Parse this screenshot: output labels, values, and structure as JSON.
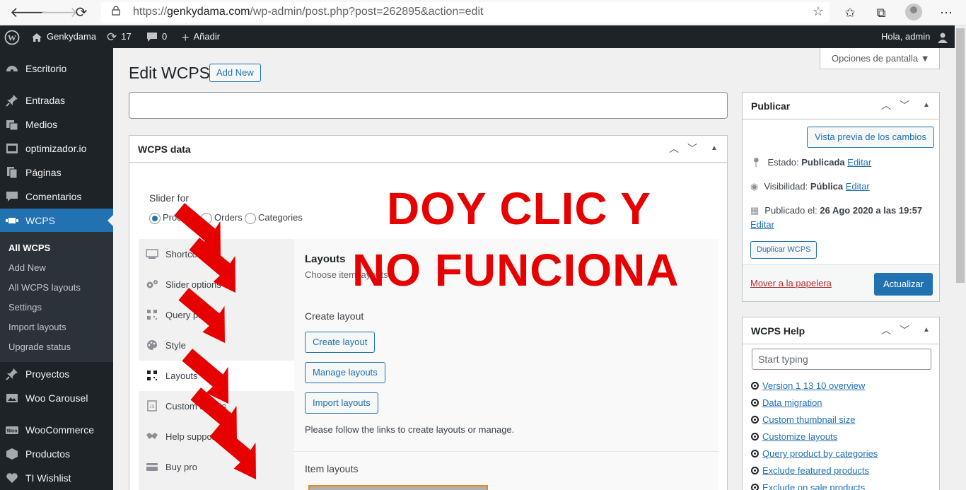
{
  "browser": {
    "url_prefix": "https://",
    "url_domain": "genkydama.com",
    "url_path": "/wp-admin/post.php?post=262895&action=edit"
  },
  "adminbar": {
    "site_name": "Genkydama",
    "updates_count": "17",
    "comments_count": "0",
    "add_new": "Añadir",
    "greeting": "Hola, admin"
  },
  "sidebar": {
    "items": [
      {
        "label": "Escritorio",
        "icon": "dashboard-icon"
      },
      {
        "label": "Entradas",
        "icon": "pin-icon"
      },
      {
        "label": "Medios",
        "icon": "media-icon"
      },
      {
        "label": "optimizador.io",
        "icon": "optimizer-icon"
      },
      {
        "label": "Páginas",
        "icon": "pages-icon"
      },
      {
        "label": "Comentarios",
        "icon": "comments-icon"
      },
      {
        "label": "WCPS",
        "icon": "slider-icon"
      },
      {
        "label": "Proyectos",
        "icon": "pin-icon"
      },
      {
        "label": "Woo Carousel",
        "icon": "carousel-icon"
      },
      {
        "label": "WooCommerce",
        "icon": "woo-icon"
      },
      {
        "label": "Productos",
        "icon": "box-icon"
      },
      {
        "label": "TI Wishlist",
        "icon": "heart-icon"
      }
    ],
    "submenu": [
      "All WCPS",
      "Add New",
      "All WCPS layouts",
      "Settings",
      "Import layouts",
      "Upgrade status"
    ]
  },
  "screen_options": "Opciones de pantalla ▼",
  "page": {
    "title": "Edit WCPS",
    "add_new": "Add New"
  },
  "wcps_box": {
    "title": "WCPS data",
    "slider_for_label": "Slider for",
    "radios": [
      {
        "label": "Products",
        "checked": true
      },
      {
        "label": "Orders",
        "checked": false
      },
      {
        "label": "Categories",
        "checked": false
      }
    ],
    "tabs": [
      {
        "label": "Shortcode",
        "icon": "shortcode-icon"
      },
      {
        "label": "Slider options",
        "icon": "gears-icon"
      },
      {
        "label": "Query product",
        "icon": "qr-icon"
      },
      {
        "label": "Style",
        "icon": "palette-icon"
      },
      {
        "label": "Layouts",
        "icon": "qr-icon"
      },
      {
        "label": "Custom scripts",
        "icon": "script-icon"
      },
      {
        "label": "Help support",
        "icon": "handshake-icon"
      },
      {
        "label": "Buy pro",
        "icon": "cart-icon"
      }
    ],
    "content": {
      "heading": "Layouts",
      "subheading": "Choose item layouts.",
      "create_label": "Create layout",
      "create_button": "Create layout",
      "manage_button": "Manage layouts",
      "import_button": "Import layouts",
      "note": "Please follow the links to create layouts or manage.",
      "item_layouts": "Item layouts"
    }
  },
  "publish_box": {
    "title": "Publicar",
    "preview_button": "Vista previa de los cambios",
    "status_label": "Estado:",
    "status_value": "Publicada",
    "visibility_label": "Visibilidad:",
    "visibility_value": "Pública",
    "published_label": "Publicado el:",
    "published_value": "26 Ago 2020 a las 19:57",
    "edit_link": "Editar",
    "duplicate_button": "Duplicar WCPS",
    "trash_link": "Mover a la papelera",
    "update_button": "Actualizar"
  },
  "help_box": {
    "title": "WCPS Help",
    "search_placeholder": "Start typing",
    "links": [
      "Version 1 13 10 overview",
      "Data migration",
      "Custom thumbnail size",
      "Customize layouts",
      "Query product by categories",
      "Exclude featured products",
      "Exclude on sale products"
    ]
  },
  "annotation": {
    "line1": "DOY CLIC Y",
    "line2": "NO FUNCIONA",
    "color": "#e60000"
  }
}
